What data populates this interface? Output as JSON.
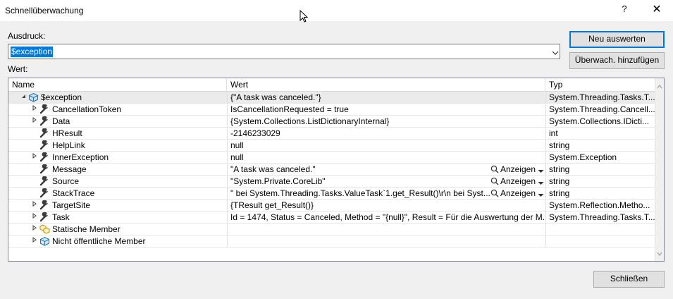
{
  "window": {
    "title": "Schnellüberwachung",
    "help_label": "?",
    "close_label": "✕"
  },
  "expression": {
    "label": "Ausdruck:",
    "value": "$exception"
  },
  "value_label": "Wert:",
  "buttons": {
    "reevaluate": "Neu auswerten",
    "add_watch": "Überwach. hinzufügen",
    "close": "Schließen"
  },
  "grid": {
    "columns": [
      "Name",
      "Wert",
      "Typ"
    ],
    "view_label": "Anzeigen",
    "rows": [
      {
        "name": "$exception",
        "value": "{\"A task was canceled.\"}",
        "type": "System.Threading.Tasks.T...",
        "level": 0,
        "expander": "expanded",
        "icon": "object-icon",
        "selected": true,
        "viewer": false
      },
      {
        "name": "CancellationToken",
        "value": "IsCancellationRequested = true",
        "type": "System.Threading.Cancell...",
        "level": 1,
        "expander": "collapsed",
        "icon": "wrench-icon",
        "selected": false,
        "viewer": false
      },
      {
        "name": "Data",
        "value": "{System.Collections.ListDictionaryInternal}",
        "type": "System.Collections.IDicti...",
        "level": 1,
        "expander": "collapsed",
        "icon": "wrench-icon",
        "selected": false,
        "viewer": false
      },
      {
        "name": "HResult",
        "value": "-2146233029",
        "type": "int",
        "level": 1,
        "expander": "none",
        "icon": "wrench-icon",
        "selected": false,
        "viewer": false
      },
      {
        "name": "HelpLink",
        "value": "null",
        "type": "string",
        "level": 1,
        "expander": "none",
        "icon": "wrench-icon",
        "selected": false,
        "viewer": false
      },
      {
        "name": "InnerException",
        "value": "null",
        "type": "System.Exception",
        "level": 1,
        "expander": "collapsed",
        "icon": "wrench-icon",
        "selected": false,
        "viewer": false
      },
      {
        "name": "Message",
        "value": "\"A task was canceled.\"",
        "type": "string",
        "level": 1,
        "expander": "none",
        "icon": "wrench-icon",
        "selected": false,
        "viewer": true
      },
      {
        "name": "Source",
        "value": "\"System.Private.CoreLib\"",
        "type": "string",
        "level": 1,
        "expander": "none",
        "icon": "wrench-icon",
        "selected": false,
        "viewer": true
      },
      {
        "name": "StackTrace",
        "value": "\"   bei System.Threading.Tasks.ValueTask`1.get_Result()\\r\\n   bei Syst...",
        "type": "string",
        "level": 1,
        "expander": "none",
        "icon": "wrench-icon",
        "selected": false,
        "viewer": true
      },
      {
        "name": "TargetSite",
        "value": "{TResult get_Result()}",
        "type": "System.Reflection.Metho...",
        "level": 1,
        "expander": "collapsed",
        "icon": "wrench-icon",
        "selected": false,
        "viewer": false
      },
      {
        "name": "Task",
        "value": "Id = 1474, Status = Canceled, Method = \"{null}\", Result = Für die Auswertung der M...",
        "type": "System.Threading.Tasks.T...",
        "level": 1,
        "expander": "collapsed",
        "icon": "wrench-icon",
        "selected": false,
        "viewer": false
      },
      {
        "name": "Statische Member",
        "value": "",
        "type": "",
        "level": 1,
        "expander": "collapsed",
        "icon": "static-members-icon",
        "selected": false,
        "viewer": false
      },
      {
        "name": "Nicht öffentliche Member",
        "value": "",
        "type": "",
        "level": 1,
        "expander": "collapsed",
        "icon": "non-public-members-icon",
        "selected": false,
        "viewer": false
      }
    ]
  },
  "colors": {
    "accent": "#0078d7",
    "wrench": "#3c3c3c",
    "object_icon": "#1e77c3",
    "static_icon": "#c28a00"
  }
}
